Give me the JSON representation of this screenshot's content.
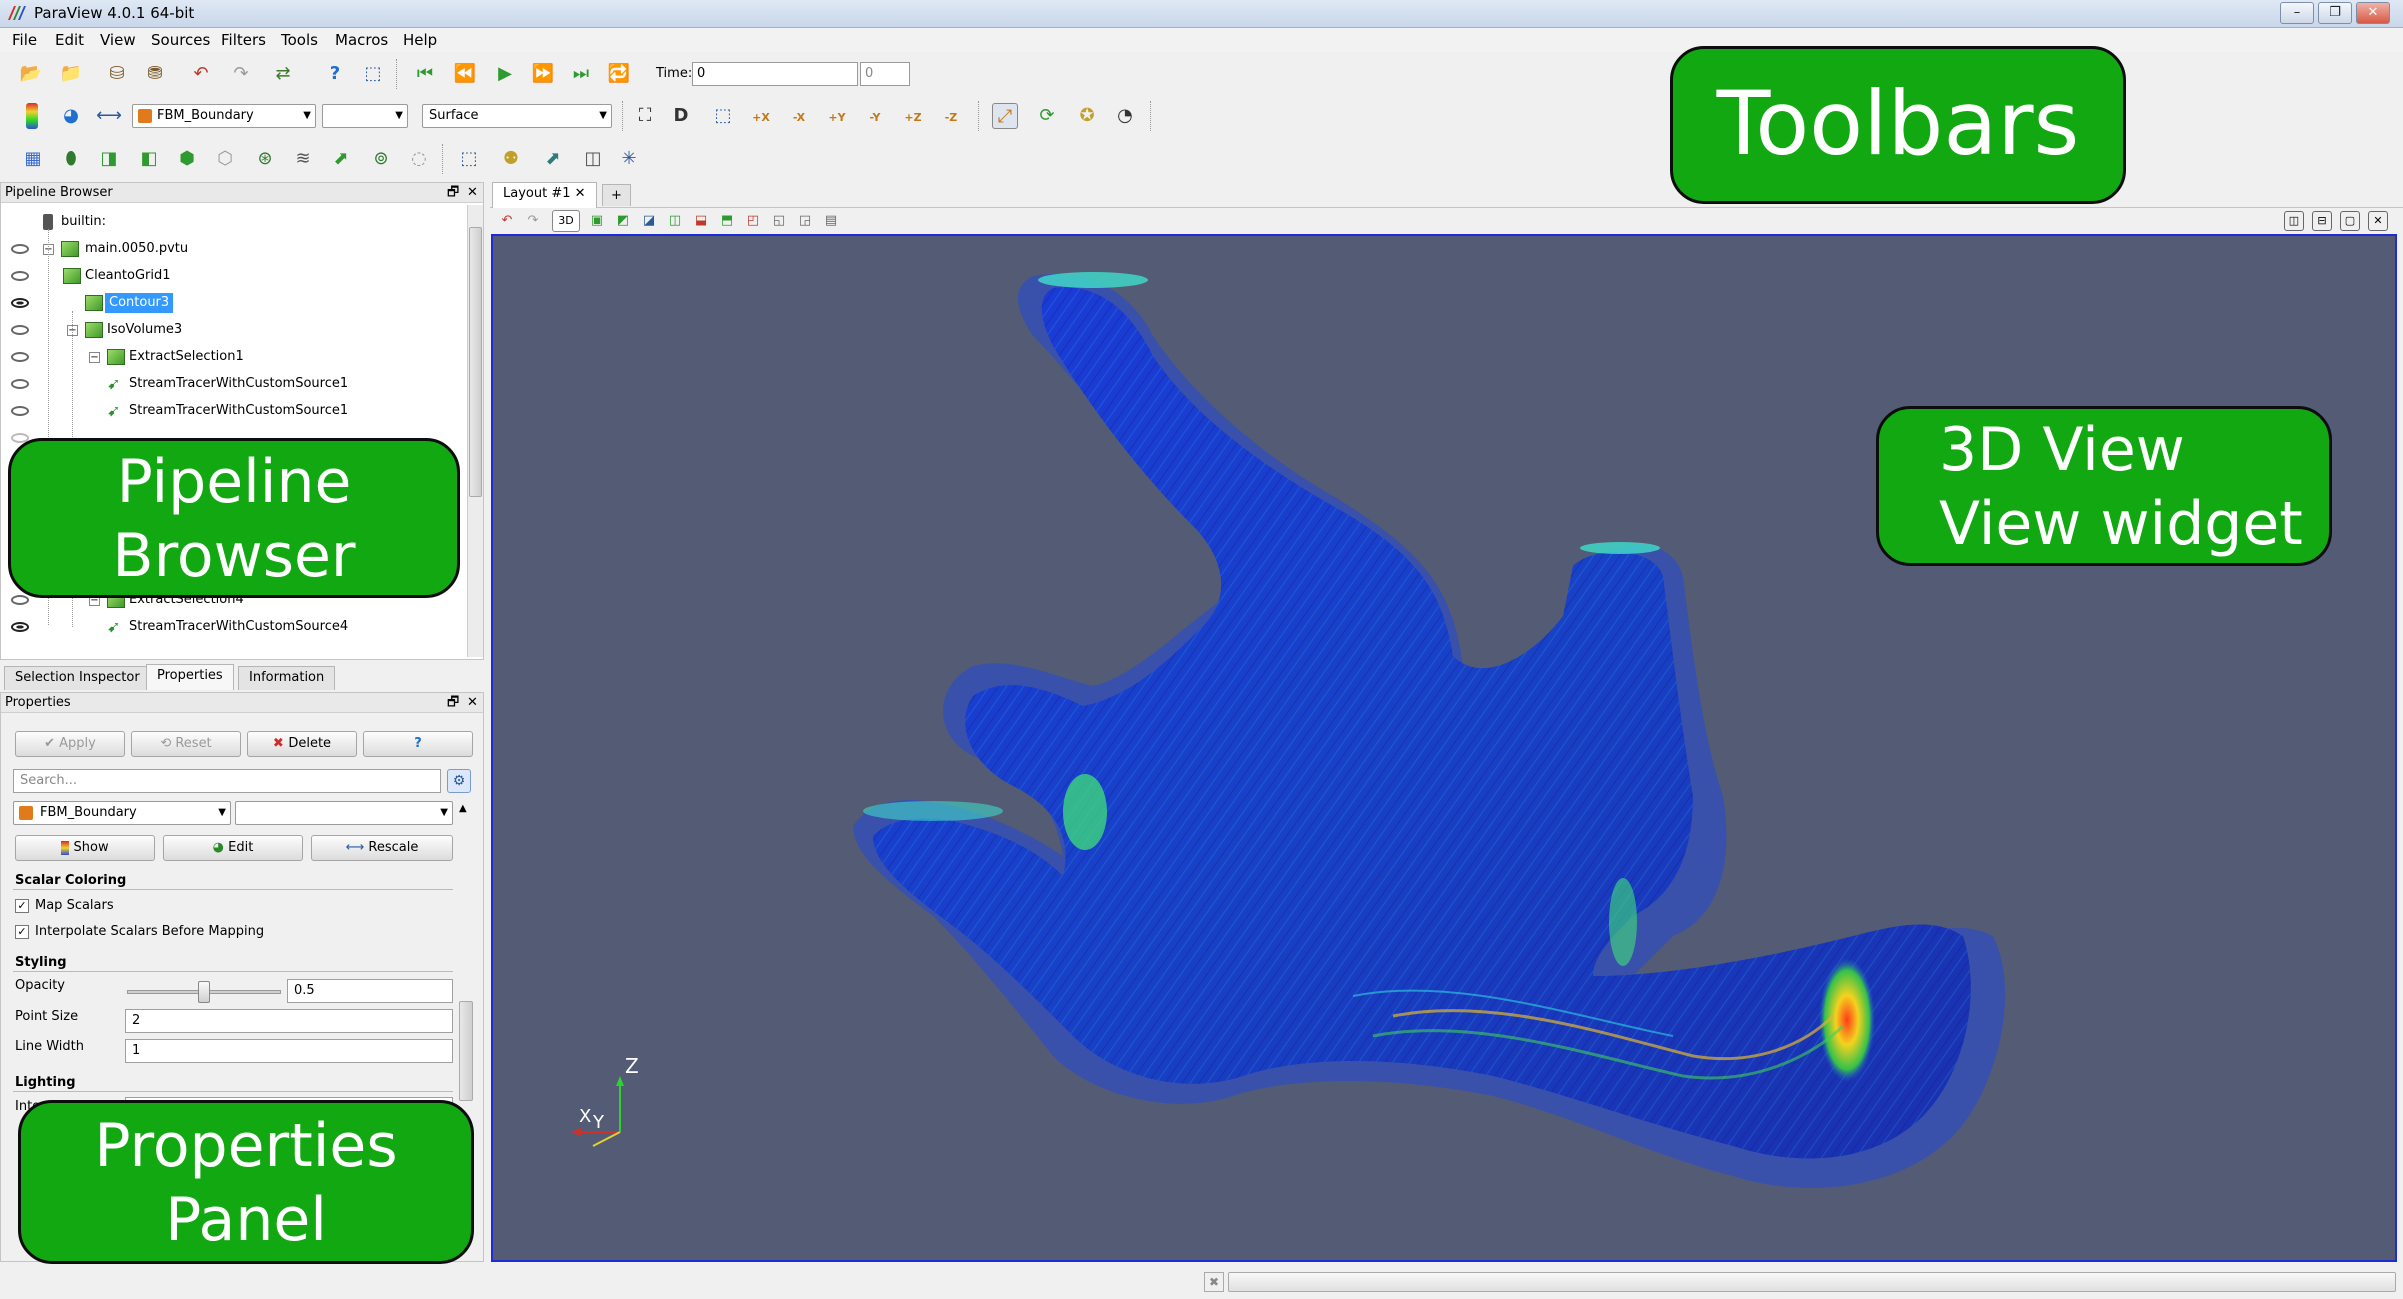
{
  "window": {
    "title": "ParaView 4.0.1 64-bit",
    "minimize_icon": "minimize-icon",
    "restore_icon": "restore-icon",
    "close_icon": "close-icon"
  },
  "menu": [
    "File",
    "Edit",
    "View",
    "Sources",
    "Filters",
    "Tools",
    "Macros",
    "Help"
  ],
  "toolbar": {
    "time_label": "Time:",
    "time_value": "0",
    "timestep_value": "0",
    "array_combo": "FBM_Boundary",
    "component_combo": "",
    "representation_combo": "Surface",
    "camera_buttons": [
      "+X",
      "-X",
      "+Y",
      "-Y",
      "+Z",
      "-Z"
    ],
    "view_button": "3D"
  },
  "pipeline": {
    "title": "Pipeline Browser",
    "items": [
      {
        "label": "builtin:"
      },
      {
        "label": "main.0050.pvtu"
      },
      {
        "label": "CleantoGrid1"
      },
      {
        "label": "Contour3"
      },
      {
        "label": "IsoVolume3"
      },
      {
        "label": "ExtractSelection1"
      },
      {
        "label": "StreamTracerWithCustomSource1"
      },
      {
        "label": "StreamTracerWithCustomSource1"
      },
      {
        "label": "ExtractSelection4"
      },
      {
        "label": "StreamTracerWithCustomSource4"
      }
    ]
  },
  "tabs": {
    "selection_inspector": "Selection Inspector",
    "properties": "Properties",
    "information": "Information"
  },
  "properties": {
    "title": "Properties",
    "apply": "Apply",
    "reset": "Reset",
    "delete": "Delete",
    "help": "?",
    "search_placeholder": "Search...",
    "color_array": "FBM_Boundary",
    "color_component": "",
    "show": "Show",
    "edit": "Edit",
    "rescale": "Rescale",
    "scalar_coloring": "Scalar Coloring",
    "map_scalars": "Map Scalars",
    "interpolate_scalars": "Interpolate Scalars Before Mapping",
    "styling": "Styling",
    "opacity_label": "Opacity",
    "opacity_value": "0.5",
    "opacity_level": 0.5,
    "point_size_label": "Point Size",
    "point_size_value": "2",
    "line_width_label": "Line Width",
    "line_width_value": "1",
    "lighting": "Lighting",
    "lighting_partial": "Interp"
  },
  "layout_tab": {
    "label": "Layout #1",
    "add": "+"
  },
  "view": {
    "axis_z": "Z",
    "axis_x": "X",
    "axis_y": "Y"
  },
  "callouts": {
    "toolbars": "Toolbars",
    "pipeline_line1": "Pipeline",
    "pipeline_line2": "Browser",
    "view_line1": "3D View",
    "view_line2": "View widget",
    "properties_line1": "Properties",
    "properties_line2": "Panel"
  },
  "colors": {
    "view_background": "#535c74",
    "view_border": "#1f2bd8",
    "callout_green": "#12a812",
    "selection_blue": "#3399ff"
  }
}
